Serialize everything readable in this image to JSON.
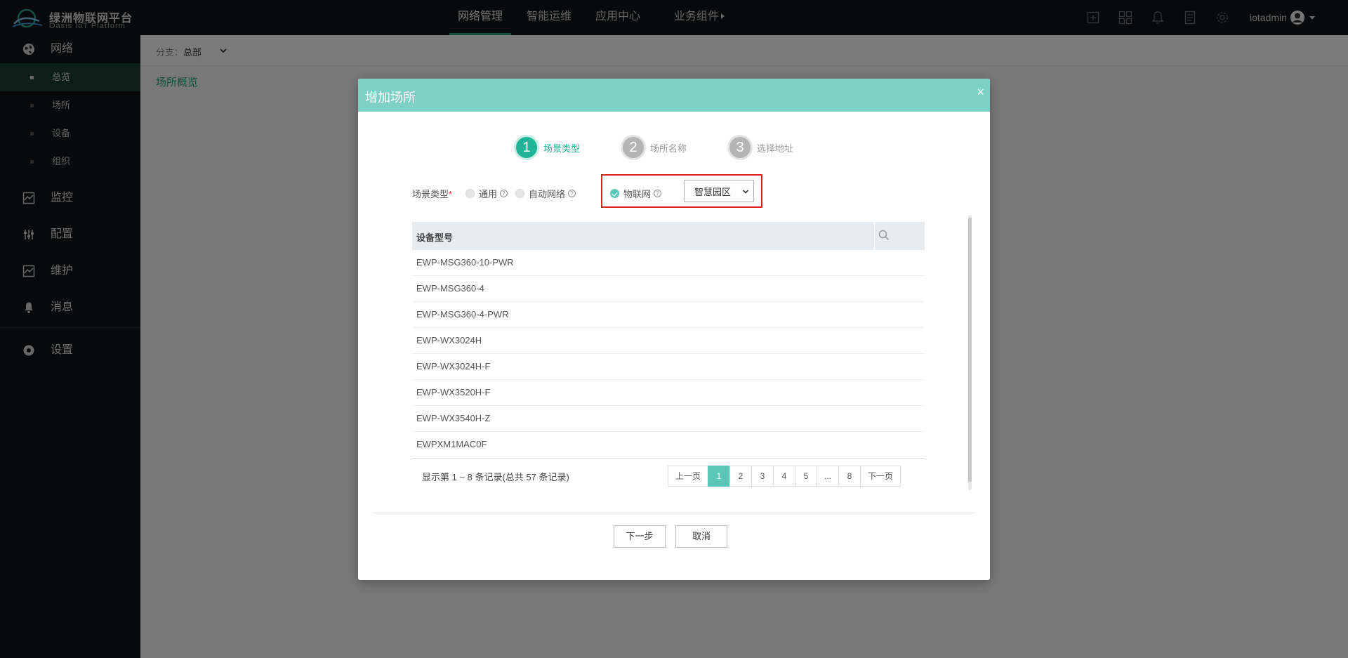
{
  "app": {
    "title": "绿洲物联网平台",
    "subtitle": "Oasis IoT Platform"
  },
  "topnav": {
    "items": [
      {
        "label": "网络管理",
        "active": true
      },
      {
        "label": "智能运维"
      },
      {
        "label": "应用中心"
      },
      {
        "label": "业务组件"
      }
    ]
  },
  "header": {
    "icons": [
      "add-square-icon",
      "apps-grid-icon",
      "bell-icon",
      "document-icon",
      "gear-icon"
    ],
    "user": "iotadmin"
  },
  "sidebar": {
    "groups": [
      {
        "label": "网络",
        "icon": "globe-icon",
        "items": [
          {
            "label": "总览",
            "active": true
          },
          {
            "label": "场所"
          },
          {
            "label": "设备"
          },
          {
            "label": "组织"
          }
        ]
      },
      {
        "label": "监控",
        "icon": "monitor-icon"
      },
      {
        "label": "配置",
        "icon": "sliders-icon"
      },
      {
        "label": "维护",
        "icon": "maintenance-icon"
      },
      {
        "label": "消息",
        "icon": "bell-icon"
      },
      {
        "label": "设置",
        "icon": "gear-icon"
      }
    ]
  },
  "content": {
    "branch_label": "分支：",
    "branch_value": "总部",
    "overview_link": "场所概览"
  },
  "modal": {
    "title": "增加场所",
    "close": "×",
    "steps": [
      {
        "num": "1",
        "label": "场景类型",
        "active": true
      },
      {
        "num": "2",
        "label": "场所名称"
      },
      {
        "num": "3",
        "label": "选择地址"
      }
    ],
    "scene": {
      "label": "场景类型",
      "required_mark": "*",
      "options": [
        {
          "label": "通用",
          "checked": false
        },
        {
          "label": "自动网络",
          "checked": false
        },
        {
          "label": "物联网",
          "checked": true
        }
      ],
      "select_value": "智慧园区"
    },
    "table": {
      "column_header": "设备型号",
      "rows": [
        "EWP-MSG360-10-PWR",
        "EWP-MSG360-4",
        "EWP-MSG360-4-PWR",
        "EWP-WX3024H",
        "EWP-WX3024H-F",
        "EWP-WX3520H-F",
        "EWP-WX3540H-Z",
        "EWPXM1MAC0F"
      ],
      "record_info": "显示第 1 ~ 8 条记录(总共 57 条记录)",
      "pager": {
        "prev": "上一页",
        "pages": [
          "1",
          "2",
          "3",
          "4",
          "5"
        ],
        "gap": "...",
        "last": "8",
        "next": "下一页",
        "current": "1"
      }
    },
    "buttons": {
      "next": "下一步",
      "cancel": "取消"
    }
  },
  "colors": {
    "accent": "#1fb497",
    "modal_header": "#7ecfc4",
    "highlight_border": "#e31b1b",
    "topbar": "#0f1215"
  }
}
